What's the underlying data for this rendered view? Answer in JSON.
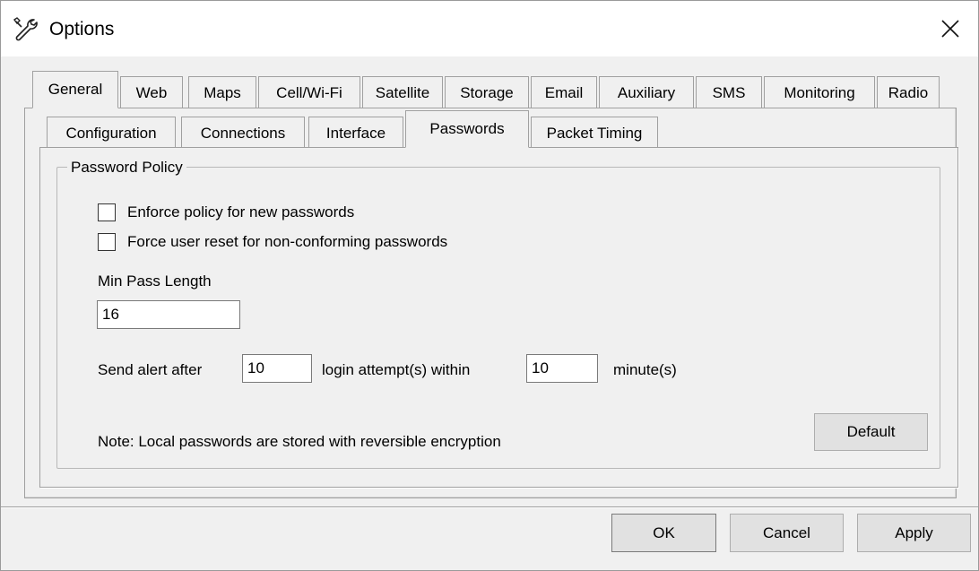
{
  "window": {
    "title": "Options",
    "close_label": "✕"
  },
  "main_tabs": [
    {
      "label": "General"
    },
    {
      "label": "Web"
    },
    {
      "label": "Maps"
    },
    {
      "label": "Cell/Wi-Fi"
    },
    {
      "label": "Satellite"
    },
    {
      "label": "Storage"
    },
    {
      "label": "Email"
    },
    {
      "label": "Auxiliary"
    },
    {
      "label": "SMS"
    },
    {
      "label": "Monitoring"
    },
    {
      "label": "Radio"
    }
  ],
  "main_tabs_active": "General",
  "sub_tabs": [
    {
      "label": "Configuration"
    },
    {
      "label": "Connections"
    },
    {
      "label": "Interface"
    },
    {
      "label": "Passwords"
    },
    {
      "label": "Packet Timing"
    }
  ],
  "sub_tabs_active": "Passwords",
  "password_policy": {
    "group_title": "Password Policy",
    "enforce_label": "Enforce policy for new passwords",
    "enforce_checked": false,
    "force_reset_label": "Force user reset for non-conforming passwords",
    "force_reset_checked": false,
    "min_length_label": "Min Pass Length",
    "min_length_value": "16",
    "alert_prefix": "Send alert after",
    "attempts_value": "10",
    "alert_middle": "login attempt(s) within",
    "minutes_value": "10",
    "alert_suffix": "minute(s)",
    "note": "Note: Local passwords are stored with reversible encryption",
    "default_button": "Default"
  },
  "footer": {
    "ok": "OK",
    "cancel": "Cancel",
    "apply": "Apply"
  }
}
